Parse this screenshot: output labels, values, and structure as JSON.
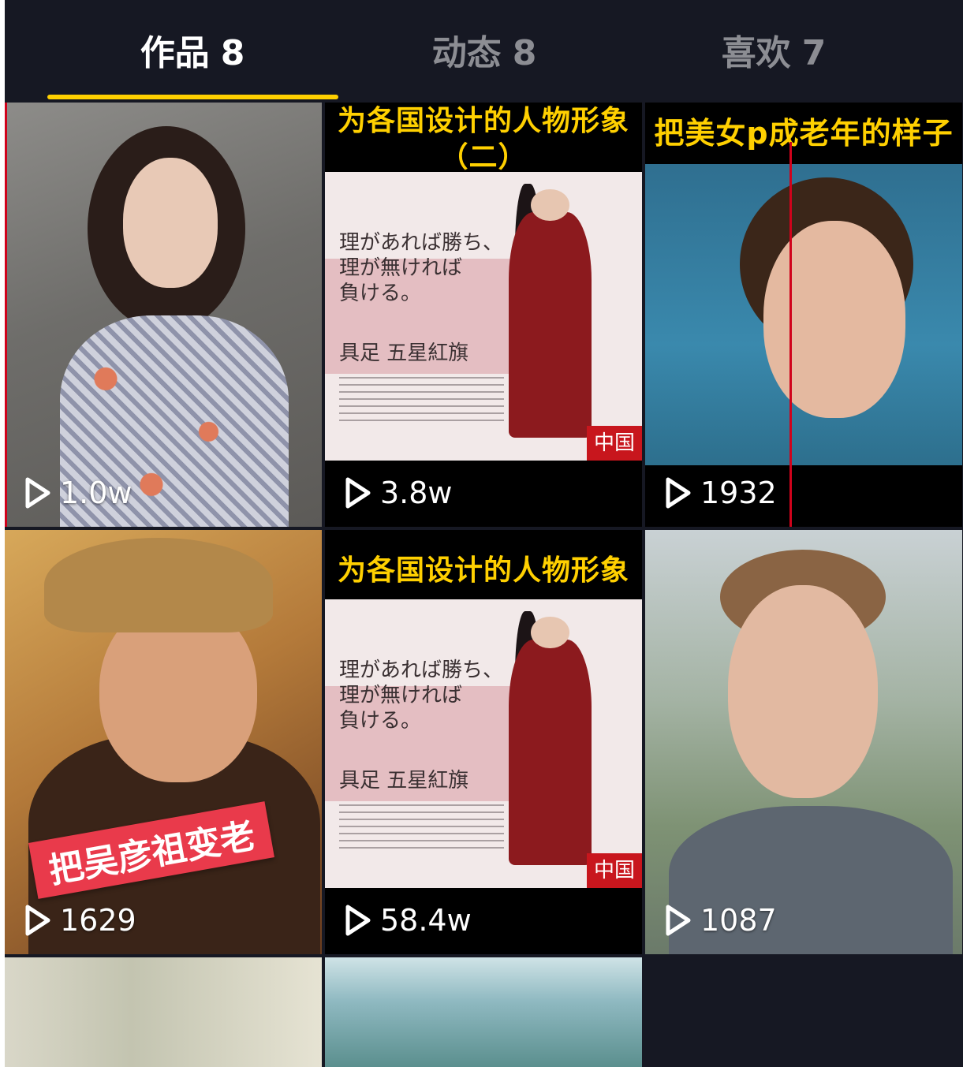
{
  "tabs": [
    {
      "label": "作品",
      "count": "8",
      "active": true
    },
    {
      "label": "动态",
      "count": "8",
      "active": false
    },
    {
      "label": "喜欢",
      "count": "7",
      "active": false
    }
  ],
  "accent_color": "#ffd000",
  "videos": [
    {
      "views": "1.0w"
    },
    {
      "views": "3.8w",
      "banner": "为各国设计的人物形象",
      "banner_sub": "（二）",
      "poster_text": [
        "理があれば勝ち、",
        "理が無ければ",
        "負ける。"
      ],
      "poster_caption": "具足 五星紅旗",
      "flag": "中国"
    },
    {
      "views": "1932",
      "banner": "把美女p成老年的样子"
    },
    {
      "views": "1629",
      "tag": "把吴彦祖变老"
    },
    {
      "views": "58.4w",
      "banner": "为各国设计的人物形象",
      "poster_text": [
        "理があれば勝ち、",
        "理が無ければ",
        "負ける。"
      ],
      "poster_caption": "具足 五星紅旗",
      "flag": "中国"
    },
    {
      "views": "1087"
    }
  ],
  "icons": {
    "play": "play-icon"
  }
}
